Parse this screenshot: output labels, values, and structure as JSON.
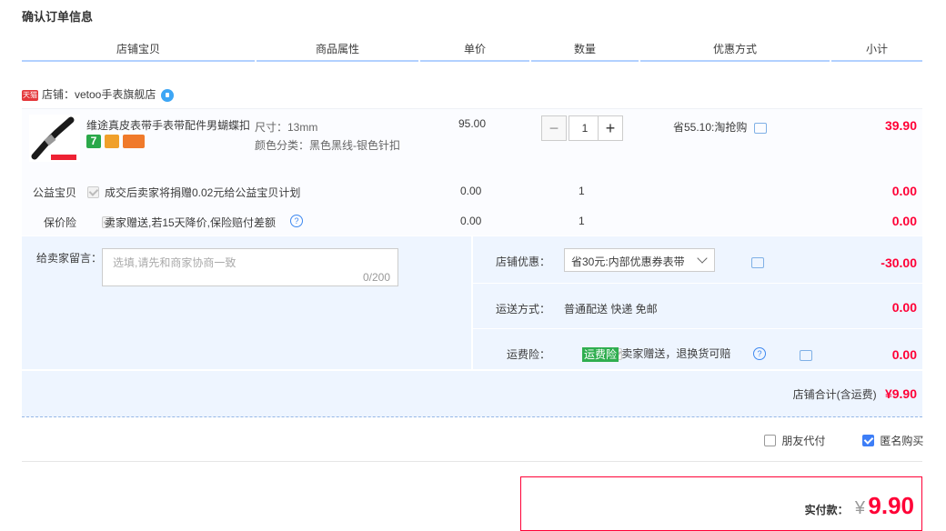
{
  "page": {
    "title": "确认订单信息"
  },
  "columns": [
    "店铺宝贝",
    "商品属性",
    "单价",
    "数量",
    "优惠方式",
    "小计"
  ],
  "shop": {
    "tag": "天猫",
    "name": "店铺：vetoo手表旗舰店"
  },
  "product": {
    "name": "维途真皮表带手表带配件男蝴蝶扣",
    "badges": [
      "7"
    ],
    "attr_size": "尺寸：13mm",
    "attr_color": "颜色分类：黑色黑线-银色针扣",
    "price": "95.00",
    "quantity": "1",
    "discount": "省55.10:淘抢购",
    "subtotal": "39.90",
    "colors": {
      "red": "#ff0036",
      "accent": "#3d7ef7"
    }
  },
  "charity": {
    "label": "公益宝贝",
    "desc": "成交后卖家将捐赠0.02元给公益宝贝计划",
    "price": "0.00",
    "qty": "1",
    "subtotal": "0.00"
  },
  "insurance": {
    "label": "保价险",
    "desc": "卖家赠送,若15天降价,保险赔付差额",
    "price": "0.00",
    "qty": "1",
    "subtotal": "0.00"
  },
  "message": {
    "label": "给卖家留言：",
    "placeholder": "选填,请先和商家协商一致",
    "count": "0/200"
  },
  "shop_coupon": {
    "label": "店铺优惠：",
    "selected": "省30元:内部优惠券表带",
    "value": "-30.00"
  },
  "shipping": {
    "label": "运送方式：",
    "value": "普通配送 快递 免邮",
    "subtotal": "0.00"
  },
  "freight_ins": {
    "label": "运费险：",
    "tag": "运费险",
    "desc": "卖家赠送，退换货可赔",
    "subtotal": "0.00"
  },
  "shop_total": {
    "label": "店铺合计(含运费)",
    "value": "¥9.90"
  },
  "options": {
    "friend_pay": "朋友代付",
    "anonymous": "匿名购买"
  },
  "payment": {
    "label": "实付款：",
    "currency": "¥",
    "amount": "9.90"
  }
}
